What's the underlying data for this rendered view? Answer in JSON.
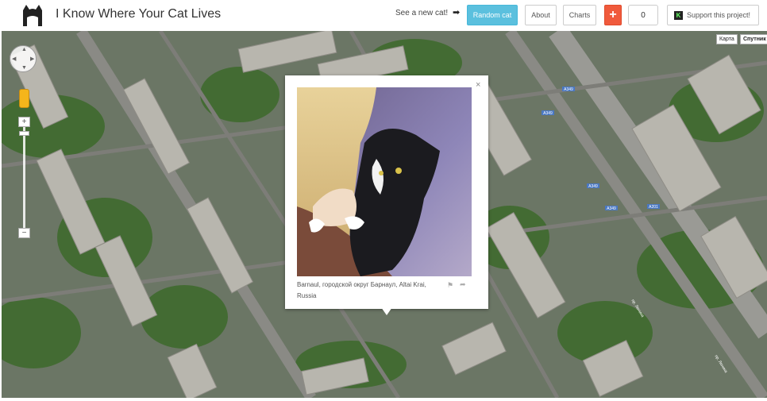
{
  "header": {
    "title": "I Know Where Your Cat Lives",
    "see_new": "See a new cat!",
    "arrow": "➡",
    "random_label": "Random cat",
    "about_label": "About",
    "charts_label": "Charts",
    "plus_label": "+",
    "count": "0",
    "support_badge": "K",
    "support_label": "Support this project!"
  },
  "map": {
    "type_map": "Карта",
    "type_satellite": "Спутник",
    "zoom_in": "+",
    "zoom_out": "−",
    "road_labels": [
      "A349",
      "A349",
      "A349",
      "A349",
      "A201",
      "пр. Ленина",
      "пр. Ленина"
    ]
  },
  "info_window": {
    "close": "×",
    "location": "Barnaul, городской округ Барнаул, Altai Krai, Russia",
    "flag_icon": "⚑",
    "share_icon": "➦"
  },
  "colors": {
    "random_btn": "#5bc0de",
    "plus_btn": "#f05a3c"
  }
}
